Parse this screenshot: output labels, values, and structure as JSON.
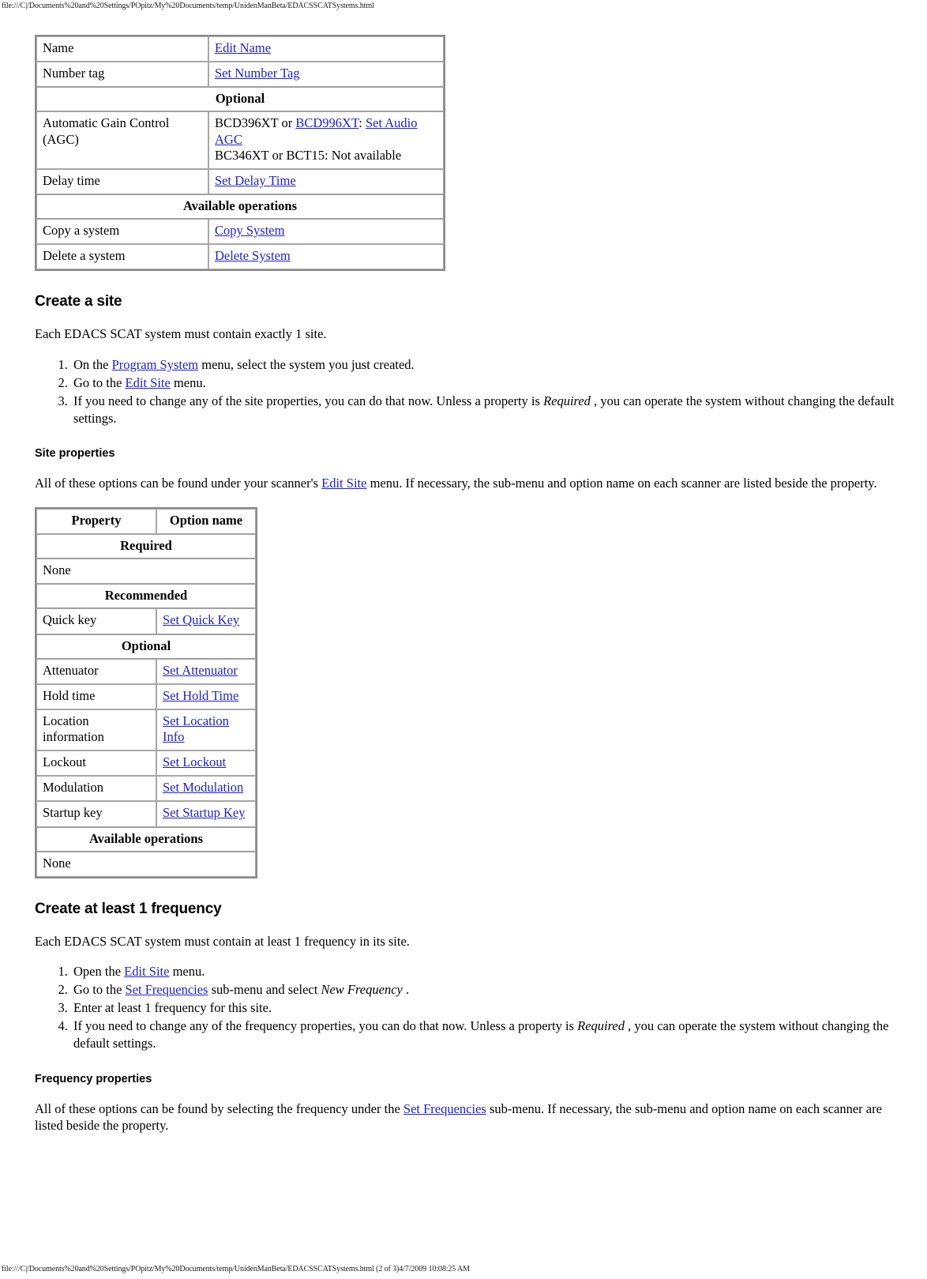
{
  "page": {
    "url_top": "file:///C|/Documents%20and%20Settings/POpitz/My%20Documents/temp/UnidenManBeta/EDACSSCATSystems.html",
    "url_bottom": "file:///C|/Documents%20and%20Settings/POpitz/My%20Documents/temp/UnidenManBeta/EDACSSCATSystems.html (2 of 3)4/7/2009 10:08:25 AM"
  },
  "colors": {
    "required_band": "#ccffcc",
    "recommended_band": "#fac898",
    "optional_band": "#ffc9c9",
    "operations_band": "#7b68ee",
    "link": "#2222cc",
    "table_border": "#8a8a8a"
  },
  "system_table": {
    "rows": [
      {
        "kind": "row",
        "property": "Name",
        "option_link": "Edit Name"
      },
      {
        "kind": "row",
        "property": "Number tag",
        "option_link": "Set Number Tag"
      },
      {
        "kind": "band",
        "label": "Optional",
        "style": "optional"
      },
      {
        "kind": "row_multi",
        "property": "Automatic Gain Control (AGC)",
        "line1_pre": "BCD396XT or ",
        "line1_link1": "BCD996XT",
        "line1_mid": ": ",
        "line1_link2": "Set Audio AGC",
        "line2": "BC346XT or BCT15: Not available"
      },
      {
        "kind": "row",
        "property": "Delay time",
        "option_link": "Set Delay Time"
      },
      {
        "kind": "band",
        "label": "Available operations",
        "style": "ops"
      },
      {
        "kind": "row",
        "property": "Copy a system",
        "option_link": "Copy System"
      },
      {
        "kind": "row",
        "property": "Delete a system",
        "option_link": "Delete System"
      }
    ]
  },
  "create_site": {
    "heading": "Create a site",
    "intro": "Each EDACS SCAT system must contain exactly 1 site.",
    "steps": [
      {
        "pre": "On the ",
        "link": "Program System",
        "post": " menu, select the system you just created."
      },
      {
        "pre": "Go to the ",
        "link": "Edit Site",
        "post": " menu."
      },
      {
        "pre": "If you need to change any of the site properties, you can do that now. Unless a property is ",
        "em": "Required",
        "post": " , you can operate the system without changing the default settings."
      }
    ]
  },
  "site_properties": {
    "heading": "Site properties",
    "intro_pre": "All of these options can be found under your scanner's ",
    "intro_link": "Edit Site",
    "intro_post": " menu. If necessary, the sub-menu and option name on each scanner are listed beside the property.",
    "header": {
      "property": "Property",
      "option_name": "Option name"
    },
    "rows": [
      {
        "kind": "band",
        "label": "Required",
        "style": "required"
      },
      {
        "kind": "full",
        "property": "None"
      },
      {
        "kind": "band",
        "label": "Recommended",
        "style": "recommended"
      },
      {
        "kind": "row",
        "property": "Quick key",
        "option_link": "Set Quick Key"
      },
      {
        "kind": "band",
        "label": "Optional",
        "style": "optional"
      },
      {
        "kind": "row",
        "property": "Attenuator",
        "option_link": "Set Attenuator"
      },
      {
        "kind": "row",
        "property": "Hold time",
        "option_link": "Set Hold Time"
      },
      {
        "kind": "row",
        "property": "Location information",
        "option_link": "Set Location Info"
      },
      {
        "kind": "row",
        "property": "Lockout",
        "option_link": "Set Lockout"
      },
      {
        "kind": "row",
        "property": "Modulation",
        "option_link": "Set Modulation"
      },
      {
        "kind": "row",
        "property": "Startup key",
        "option_link": "Set Startup Key"
      },
      {
        "kind": "band",
        "label": "Available operations",
        "style": "ops"
      },
      {
        "kind": "full",
        "property": "None"
      }
    ]
  },
  "create_frequency": {
    "heading": "Create at least 1 frequency",
    "intro": "Each EDACS SCAT system must contain at least 1 frequency in its site.",
    "steps": [
      {
        "pre": "Open the ",
        "link": "Edit Site",
        "post": " menu."
      },
      {
        "pre": "Go to the ",
        "link": "Set Frequencies",
        "post": " sub-menu and select ",
        "em": "New Frequency",
        "tail": " ."
      },
      {
        "pre": "Enter at least 1 frequency for this site."
      },
      {
        "pre": "If you need to change any of the frequency properties, you can do that now. Unless a property is ",
        "em": "Required",
        "post": " , you can operate the system without changing the default settings."
      }
    ]
  },
  "frequency_properties": {
    "heading": "Frequency properties",
    "intro_pre": "All of these options can be found by selecting the frequency under the ",
    "intro_link": "Set Frequencies",
    "intro_post": " sub-menu. If necessary, the sub-menu and option name on each scanner are listed beside the property."
  }
}
